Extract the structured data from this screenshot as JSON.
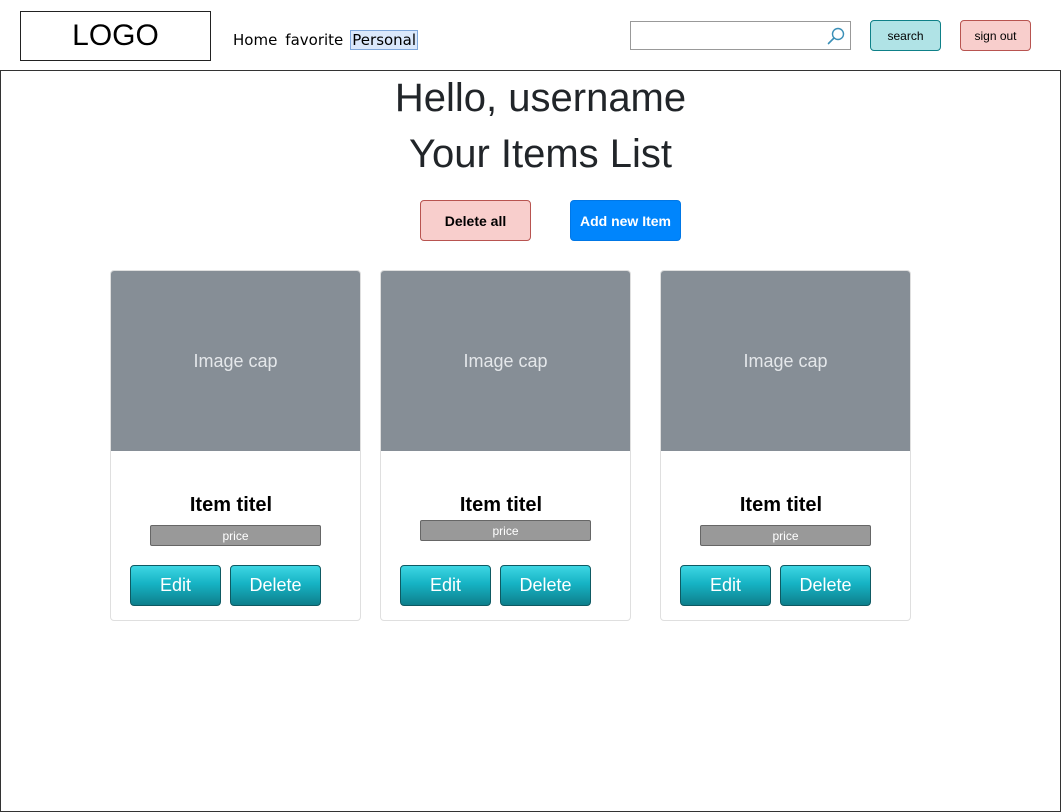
{
  "header": {
    "logo": "LOGO",
    "nav": [
      {
        "label": "Home"
      },
      {
        "label": "favorite"
      },
      {
        "label": "Personal"
      }
    ],
    "search": {
      "placeholder": "",
      "button_label": "search"
    },
    "signout_label": "sign out"
  },
  "main": {
    "greeting": "Hello, username",
    "title": "Your Items List",
    "delete_all_label": "Delete all",
    "add_new_label": "Add new Item",
    "cards": [
      {
        "image": "Image cap",
        "title": "Item titel",
        "price": "price",
        "edit": "Edit",
        "delete": "Delete"
      },
      {
        "image": "Image cap",
        "title": "Item titel",
        "price": "price",
        "edit": "Edit",
        "delete": "Delete"
      },
      {
        "image": "Image cap",
        "title": "Item titel",
        "price": "price",
        "edit": "Edit",
        "delete": "Delete"
      }
    ]
  },
  "colors": {
    "search_button": "#b0e3e6",
    "signout_button": "#f8cecc",
    "delete_all_button": "#f8cecc",
    "add_button": "#0085fc",
    "image_cap": "#868e96",
    "card_button": "#16b3c4",
    "price_badge": "#999999"
  },
  "icons": {
    "search": "magnifier-icon"
  }
}
